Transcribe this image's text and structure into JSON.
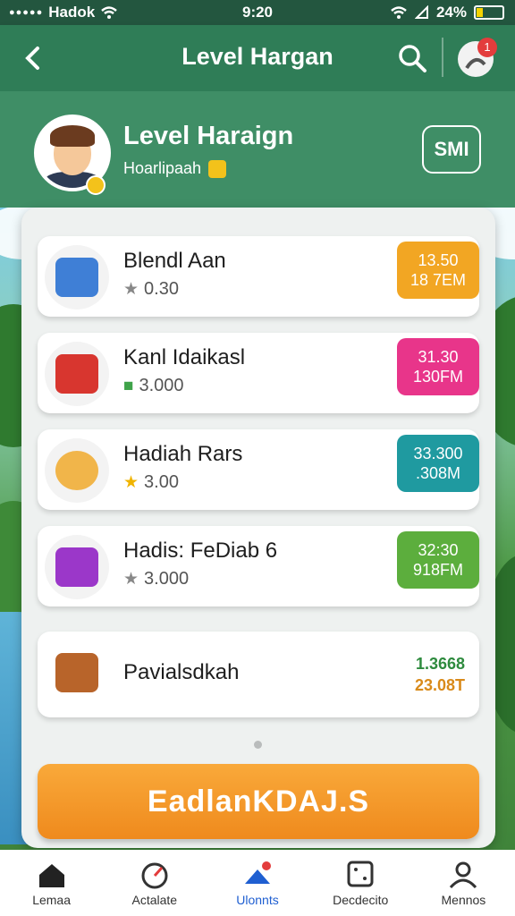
{
  "status": {
    "carrier": "Hadok",
    "time": "9:20",
    "battery": "24%"
  },
  "header": {
    "title": "Level Hargan",
    "notification_count": "1"
  },
  "profile": {
    "name": "Level Haraign",
    "subtitle": "Hoarlipaah",
    "button": "SMI"
  },
  "items": [
    {
      "title": "Blendl Aan",
      "sub_symbol": "★",
      "sub_value": "0.30",
      "badge_line1": "13.50",
      "badge_line2": "18 7EM",
      "badge_color": "#f2a623",
      "icon_color": "#3f7fd6"
    },
    {
      "title": "Kanl Idaikasl",
      "sub_symbol": "■",
      "sub_value": "3.000",
      "badge_line1": "31.30",
      "badge_line2": "130FM",
      "badge_color": "#e8358a",
      "icon_color": "#d8362f"
    },
    {
      "title": "Hadiah Rars",
      "sub_symbol": "★",
      "sub_value": "3.00",
      "badge_line1": "33.300",
      "badge_line2": ".308M",
      "badge_color": "#1f9aa0",
      "icon_color": "#f1b54a"
    },
    {
      "title": "Hadis: FeDiab 6",
      "sub_symbol": "★",
      "sub_value": "3.000",
      "badge_line1": "32:30",
      "badge_line2": "918FM",
      "badge_color": "#5cae3d",
      "icon_color": "#9b37c9"
    }
  ],
  "item5": {
    "title": "Pavialsdkah",
    "value_line1": "1.3668",
    "value_line2": "23.08T"
  },
  "cta": {
    "label": "EadlanKDAJ.S"
  },
  "tabs": [
    {
      "label": "Lemaa"
    },
    {
      "label": "Actalate"
    },
    {
      "label": "Ulonnts"
    },
    {
      "label": "Decdecito"
    },
    {
      "label": "Mennos"
    }
  ]
}
